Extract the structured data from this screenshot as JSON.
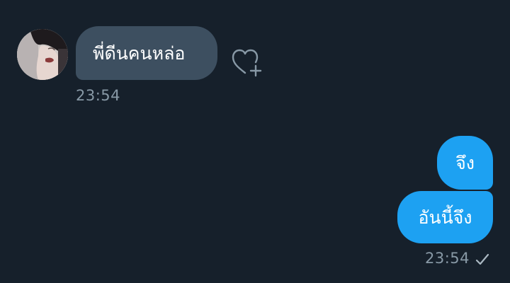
{
  "conversation": {
    "incoming": [
      {
        "text": "พี่ดีนคนหล่อ",
        "time": "23:54"
      }
    ],
    "outgoing": [
      {
        "text": "จึง"
      },
      {
        "text": "อันนี้จึง"
      }
    ],
    "outgoing_time": "23:54"
  },
  "icons": {
    "avatar": "contact-avatar",
    "like": "heart-plus-icon",
    "status": "sent-check-icon"
  },
  "colors": {
    "background": "#16202b",
    "incoming_bubble": "#3d4f60",
    "outgoing_bubble": "#1da1f2",
    "muted_text": "#8899a6"
  }
}
